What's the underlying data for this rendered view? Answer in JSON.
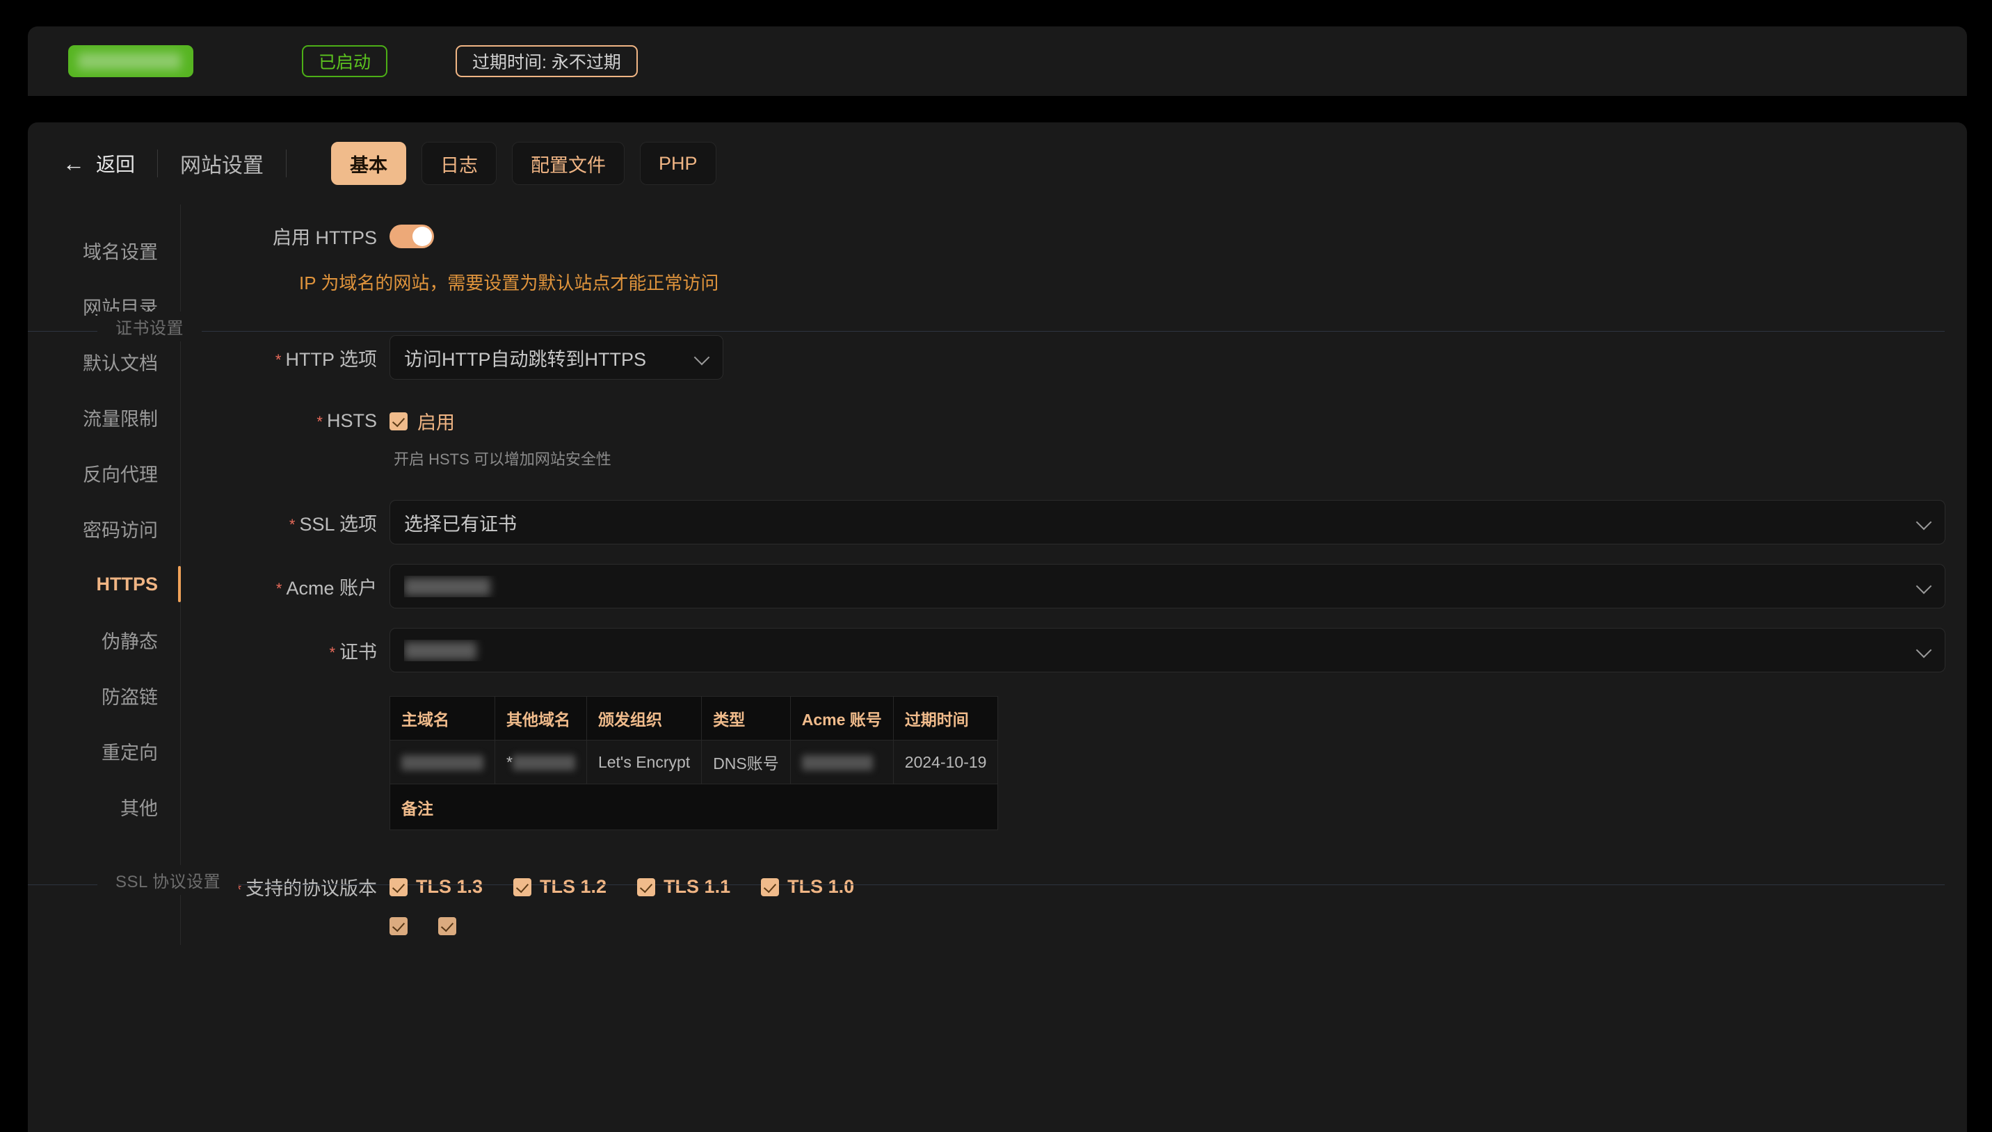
{
  "top_bar": {
    "site_badge_redacted": "",
    "status_label": "已启动",
    "expire_label": "过期时间: 永不过期"
  },
  "header": {
    "back_label": "返回",
    "back_icon": "arrow-left-icon",
    "page_title": "网站设置",
    "tabs": [
      {
        "label": "基本",
        "active": true
      },
      {
        "label": "日志",
        "active": false
      },
      {
        "label": "配置文件",
        "active": false
      },
      {
        "label": "PHP",
        "active": false
      }
    ]
  },
  "sidebar": {
    "items": [
      {
        "label": "域名设置"
      },
      {
        "label": "网站目录"
      },
      {
        "label": "默认文档"
      },
      {
        "label": "流量限制"
      },
      {
        "label": "反向代理"
      },
      {
        "label": "密码访问"
      },
      {
        "label": "HTTPS",
        "active": true
      },
      {
        "label": "伪静态"
      },
      {
        "label": "防盗链"
      },
      {
        "label": "重定向"
      },
      {
        "label": "其他"
      }
    ]
  },
  "form": {
    "https_toggle_label": "启用 HTTPS",
    "https_toggle_on": true,
    "warning": "IP 为域名的网站，需要设置为默认站点才能正常访问",
    "cert_fieldset_legend": "证书设置",
    "http_option_label": "HTTP 选项",
    "http_option_value": "访问HTTP自动跳转到HTTPS",
    "hsts_label": "HSTS",
    "hsts_checkbox_label": "启用",
    "hsts_checked": true,
    "hsts_help": "开启 HSTS 可以增加网站安全性",
    "ssl_option_label": "SSL 选项",
    "ssl_option_value": "选择已有证书",
    "acme_account_label": "Acme 账户",
    "acme_account_value": "",
    "cert_label": "证书",
    "cert_value": "",
    "required_marker": "*"
  },
  "cert_table": {
    "headers": [
      "主域名",
      "其他域名",
      "颁发组织",
      "类型",
      "Acme 账号",
      "过期时间"
    ],
    "rows": [
      {
        "main_domain": "",
        "other_domain_prefix": "*",
        "other_domain": "",
        "issuer": "Let's Encrypt",
        "type": "DNS账号",
        "acme_account": "",
        "expire": "2024-10-19"
      }
    ],
    "note_label": "备注"
  },
  "ssl_protocol": {
    "legend": "SSL 协议设置",
    "label": "支持的协议版本",
    "options": [
      {
        "label": "TLS 1.3",
        "checked": true
      },
      {
        "label": "TLS 1.2",
        "checked": true
      },
      {
        "label": "TLS 1.1",
        "checked": true
      },
      {
        "label": "TLS 1.0",
        "checked": true
      }
    ]
  },
  "colors": {
    "accent": "#f0bb8b",
    "accent_text": "#f0b584",
    "warning": "#e0943c",
    "success": "#57b522",
    "required": "#e86a5a",
    "page_bg": "#000000",
    "card_bg": "#1a1a1a"
  }
}
